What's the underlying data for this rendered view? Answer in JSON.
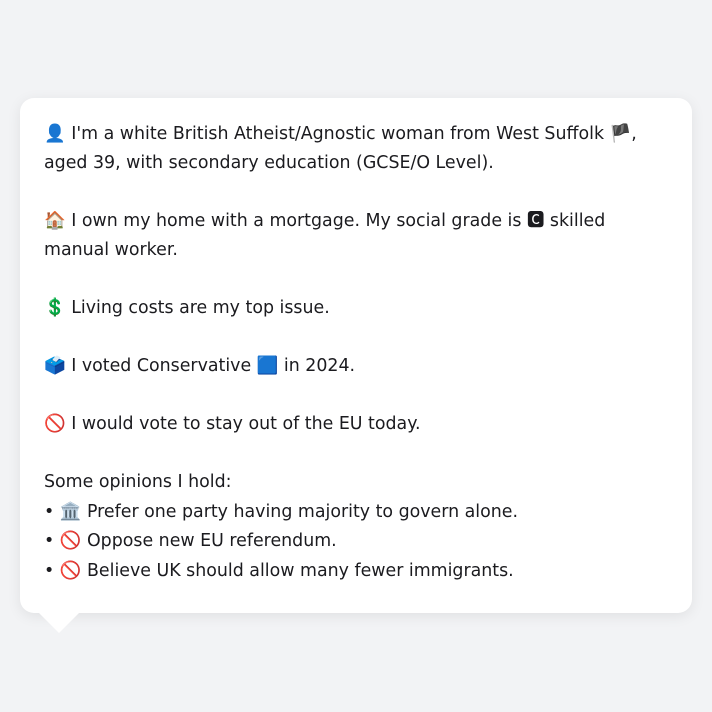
{
  "persona": {
    "identity": {
      "icon": "👤",
      "text_before_flag": "I'm a white British Atheist/Agnostic woman from West Suffolk ",
      "flag": "🏴",
      "text_after_flag": ", aged 39, with secondary education (GCSE/O Level)."
    },
    "housing": {
      "icon": "🏠",
      "text_before_grade": "I own my home with a mortgage. My social grade is ",
      "grade_icon": "🅲",
      "text_after_grade": " skilled manual worker."
    },
    "issue": {
      "icon": "💲",
      "text": "Living costs are my top issue."
    },
    "vote": {
      "icon": "🗳️",
      "text_before_party": "I voted Conservative ",
      "party_icon": "🟦",
      "text_after_party": " in 2024."
    },
    "eu": {
      "icon": "🚫",
      "text": "I would vote to stay out of the EU today."
    },
    "opinions": {
      "heading": "Some opinions I hold:",
      "bullet": "•",
      "items": [
        {
          "icon": "🏛️",
          "text": "Prefer one party having majority to govern alone."
        },
        {
          "icon": "🚫",
          "text": "Oppose new EU referendum."
        },
        {
          "icon": "🚫",
          "text": "Believe UK should allow many fewer immigrants."
        }
      ]
    }
  }
}
